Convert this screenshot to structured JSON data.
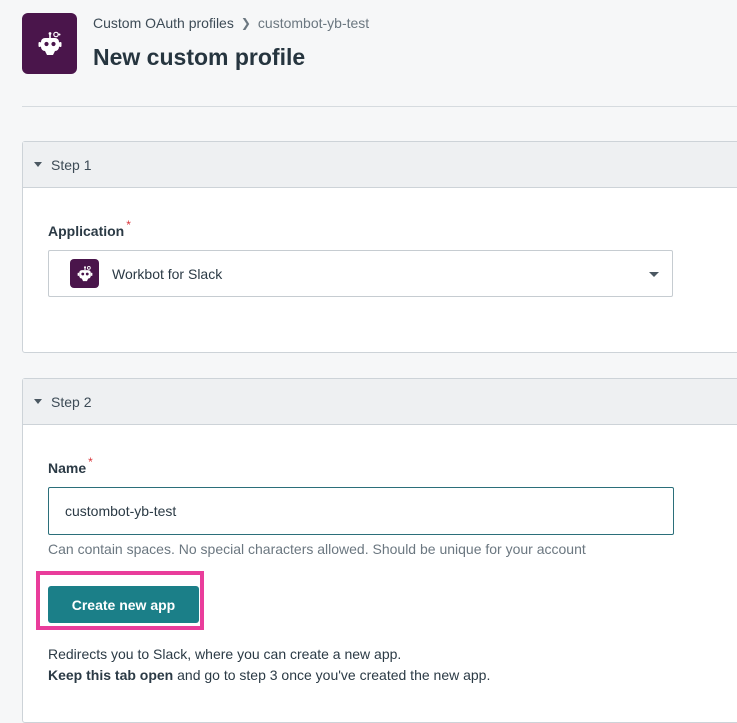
{
  "header": {
    "app_icon": "workbot-robot-icon",
    "breadcrumb": {
      "parent": "Custom OAuth profiles",
      "current": "custombot-yb-test"
    },
    "title": "New custom profile"
  },
  "step1": {
    "heading": "Step 1",
    "application_label": "Application",
    "required_mark": "*",
    "application_value": "Workbot for Slack"
  },
  "step2": {
    "heading": "Step 2",
    "name_label": "Name",
    "required_mark": "*",
    "name_value": "custombot-yb-test",
    "name_hint": "Can contain spaces. No special characters allowed. Should be unique for your account",
    "create_button": "Create new app",
    "info_line1": "Redirects you to Slack, where you can create a new app.",
    "info_line2_bold": "Keep this tab open",
    "info_line2_rest": " and go to step 3 once you've created the new app."
  },
  "colors": {
    "brand": "#4a154b",
    "primary_button": "#1b7f88",
    "highlight": "#e93d9b",
    "required": "#d8343a"
  }
}
